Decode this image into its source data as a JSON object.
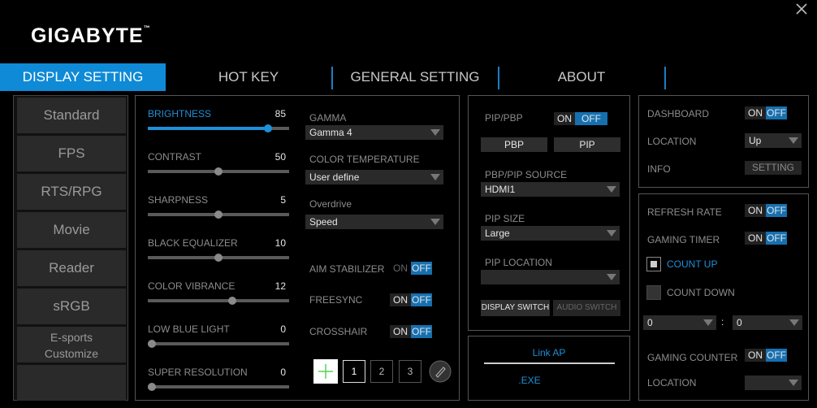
{
  "app": {
    "brand": "GIGABYTE",
    "tm": "™"
  },
  "tabs": [
    {
      "label": "DISPLAY SETTING"
    },
    {
      "label": "HOT KEY"
    },
    {
      "label": "GENERAL SETTING"
    },
    {
      "label": "ABOUT"
    }
  ],
  "presets": [
    "Standard",
    "FPS",
    "RTS/RPG",
    "Movie",
    "Reader",
    "sRGB",
    "E-sports",
    "Customize"
  ],
  "sliders": [
    {
      "label": "BRIGHTNESS",
      "value": "85",
      "level": 0.85,
      "active": true
    },
    {
      "label": "CONTRAST",
      "value": "50",
      "level": 0.5,
      "active": false
    },
    {
      "label": "SHARPNESS",
      "value": "5",
      "level": 0.5,
      "active": false
    },
    {
      "label": "BLACK EQUALIZER",
      "value": "10",
      "level": 0.5,
      "active": false
    },
    {
      "label": "COLOR VIBRANCE",
      "value": "12",
      "level": 0.6,
      "active": false
    },
    {
      "label": "LOW BLUE LIGHT",
      "value": "0",
      "level": 0,
      "active": false
    },
    {
      "label": "SUPER RESOLUTION",
      "value": "0",
      "level": 0,
      "active": false
    }
  ],
  "picture": {
    "gamma_label": "GAMMA",
    "gamma_value": "Gamma 4",
    "colortemp_label": "COLOR TEMPERATURE",
    "colortemp_value": "User define",
    "overdrive_label": "Overdrive",
    "overdrive_value": "Speed",
    "aim_label": "AIM STABILIZER",
    "freesync_label": "FREESYNC",
    "crosshair_label": "CROSSHAIR",
    "on": "ON",
    "off": "OFF",
    "crosshair_slots": [
      "1",
      "2",
      "3"
    ]
  },
  "pip": {
    "pip_label": "PIP/PBP",
    "pbp_button": "PBP",
    "pip_button": "PIP",
    "source_label": "PBP/PIP SOURCE",
    "source_value": "HDMI1",
    "size_label": "PIP SIZE",
    "size_value": "Large",
    "location_label": "PIP LOCATION",
    "location_value": "",
    "display_switch": "DISPLAY SWITCH",
    "audio_switch": "AUDIO SWITCH"
  },
  "link": {
    "link_ap": "Link AP",
    "exe": ".EXE"
  },
  "dashboard": {
    "dashboard_label": "DASHBOARD",
    "location_label": "LOCATION",
    "location_value": "Up",
    "info_label": "INFO",
    "setting_button": "SETTING"
  },
  "gaming": {
    "refresh_label": "REFRESH RATE",
    "timer_label": "GAMING TIMER",
    "count_up": "COUNT UP",
    "count_down": "COUNT DOWN",
    "time_a": "0",
    "time_sep": ":",
    "time_b": "0",
    "counter_label": "GAMING COUNTER",
    "location_label": "LOCATION",
    "location_value": ""
  },
  "colors": {
    "accent": "#0f8ad6",
    "toggle_off": "#1670b0"
  },
  "icons": [
    "close-icon",
    "crosshair-icon",
    "pencil-icon",
    "dropdown-arrow-icon"
  ]
}
